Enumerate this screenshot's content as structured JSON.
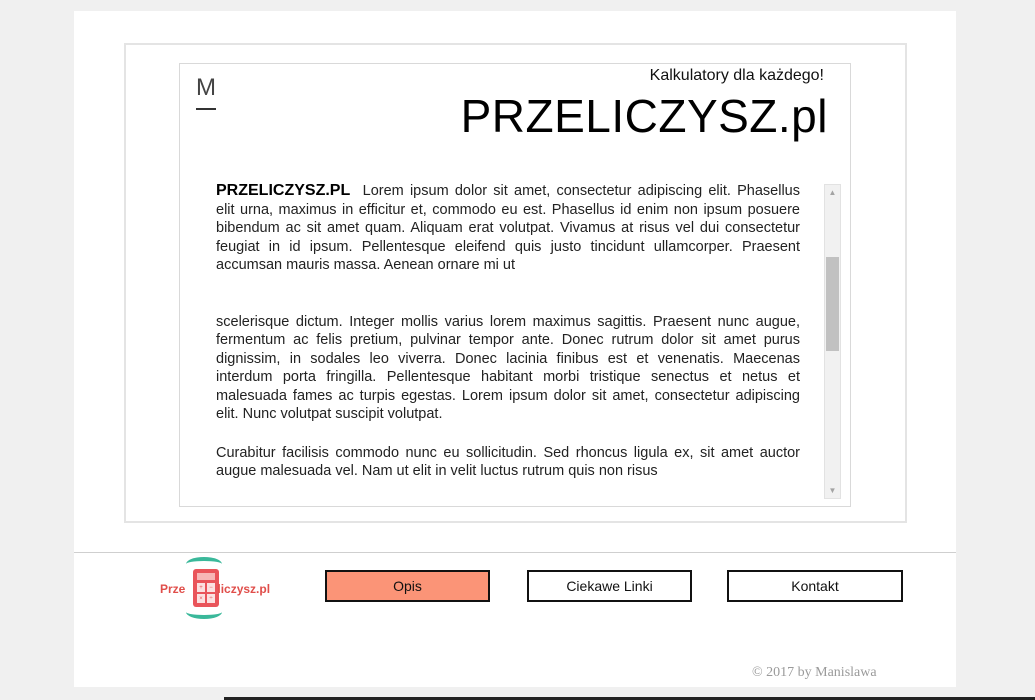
{
  "header": {
    "menu_letter": "M",
    "tagline": "Kalkulatory dla każdego!",
    "title": "PRZELICZYSZ.pl"
  },
  "article": {
    "lead": "PRZELICZYSZ.PL",
    "p1": "Lorem ipsum dolor sit amet, consectetur adipiscing elit. Phasellus elit urna, maximus in efficitur et, commodo eu est. Phasellus id enim non ipsum posuere bibendum ac sit amet quam. Aliquam erat volutpat. Vivamus at risus vel dui consectetur feugiat in id ipsum. Pellentesque eleifend quis justo tincidunt ullamcorper. Praesent accumsan mauris massa. Aenean ornare mi ut",
    "p2": "scelerisque dictum. Integer mollis varius lorem maximus sagittis. Praesent nunc augue, fermentum ac felis pretium, pulvinar tempor ante. Donec rutrum dolor sit amet purus dignissim, in sodales leo viverra. Donec lacinia finibus est et venenatis. Maecenas interdum porta fringilla. Pellentesque habitant morbi tristique senectus et netus et malesuada fames ac turpis egestas. Lorem ipsum dolor sit amet, consectetur adipiscing elit. Nunc volutpat suscipit volutpat.",
    "p3": "Curabitur facilisis commodo nunc eu sollicitudin. Sed rhoncus ligula ex, sit amet auctor augue malesuada vel. Nam ut elit in velit luctus rutrum quis non risus"
  },
  "logo": {
    "text_left": "Prze",
    "text_right": "liczysz.pl",
    "keys": [
      "+",
      "−",
      "×",
      "÷"
    ]
  },
  "nav": {
    "opis": "Opis",
    "linki": "Ciekawe Linki",
    "kontakt": "Kontakt",
    "active": "Opis"
  },
  "footer": {
    "copyright": "© 2017 by Manislawa"
  },
  "colors": {
    "accent": "#fb9477",
    "logo_red": "#e04e4a",
    "logo_green": "#3ab89a"
  }
}
